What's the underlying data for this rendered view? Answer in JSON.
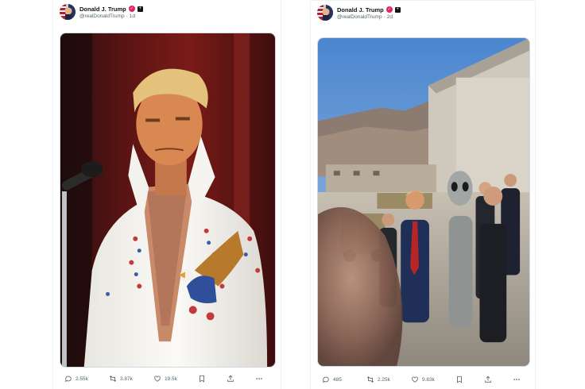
{
  "posts": [
    {
      "author": {
        "name": "Donald J. Trump",
        "handle": "@realDonaldTrump",
        "time": "1d"
      },
      "stats": {
        "replies": "2.55k",
        "reposts": "3.87k",
        "likes": "19.5k"
      },
      "image_subject": "stage-performer-portrait"
    },
    {
      "author": {
        "name": "Donald J. Trump",
        "handle": "@realDonaldTrump",
        "time": "2d"
      },
      "stats": {
        "replies": "485",
        "reposts": "2.25k",
        "likes": "9.83k"
      },
      "image_subject": "hangar-walk-scene"
    }
  ],
  "separator": "·",
  "colors": {
    "verified": "#e0245e",
    "text_secondary": "#536471",
    "border": "#cfd9de"
  },
  "icons": [
    "reply-icon",
    "repost-icon",
    "like-icon",
    "bookmark-icon",
    "share-icon",
    "more-icon",
    "verified-icon",
    "affiliate-icon"
  ]
}
